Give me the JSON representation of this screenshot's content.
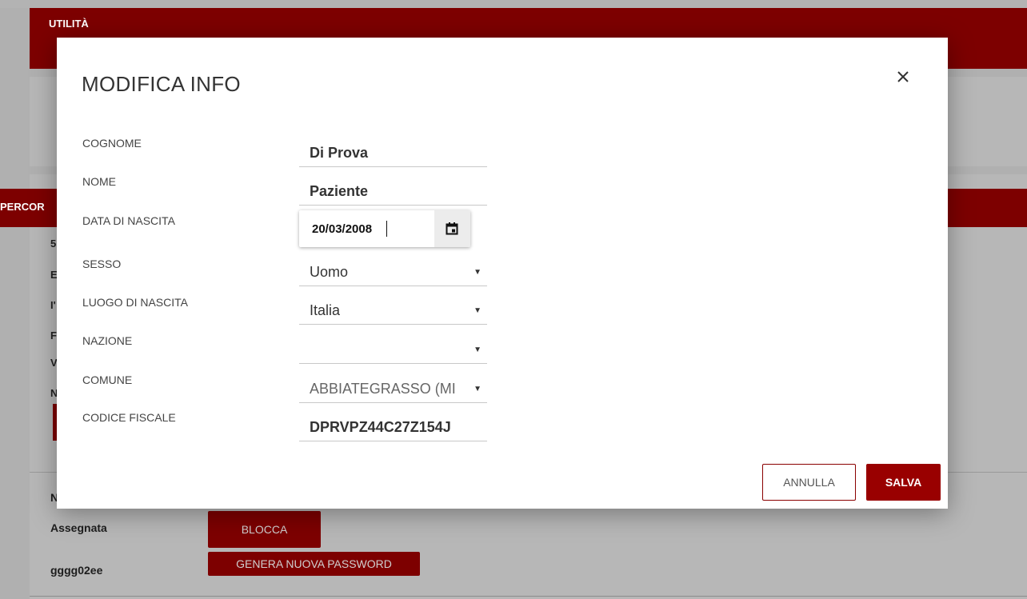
{
  "app": {
    "topbar_title": "UTILITÀ",
    "section_bar_label": "PERCOR",
    "peek_chars": [
      "5",
      "E",
      "I'",
      "F",
      "V",
      "N"
    ],
    "bottom_row_peek": "N",
    "assegnata_label": "Assegnata",
    "username_value": "gggg02ee",
    "blocca_button": "BLOCCA",
    "new_password_button": "GENERA NUOVA PASSWORD"
  },
  "modal": {
    "title": "MODIFICA INFO",
    "fields": {
      "cognome": {
        "label": "COGNOME",
        "value": "Di Prova"
      },
      "nome": {
        "label": "NOME",
        "value": "Paziente"
      },
      "data_nascita": {
        "label": "DATA DI NASCITA",
        "value": "20/03/2008"
      },
      "sesso": {
        "label": "SESSO",
        "value": "Uomo"
      },
      "luogo_nascita": {
        "label": "LUOGO DI NASCITA",
        "value": "Italia"
      },
      "nazione": {
        "label": "NAZIONE",
        "value": ""
      },
      "comune": {
        "label": "COMUNE",
        "value": "ABBIATEGRASSO (MI"
      },
      "codice_fiscale": {
        "label": "CODICE FISCALE",
        "value": "DPRVPZ44C27Z154J"
      }
    },
    "buttons": {
      "cancel": "ANNULLA",
      "save": "SALVA"
    }
  },
  "colors": {
    "brand": "#7d0000",
    "save_button": "#990000",
    "overlay": "#b0b0b0"
  },
  "icons": {
    "close": "close-icon",
    "calendar": "calendar-icon",
    "dropdown": "chevron-down-icon"
  }
}
